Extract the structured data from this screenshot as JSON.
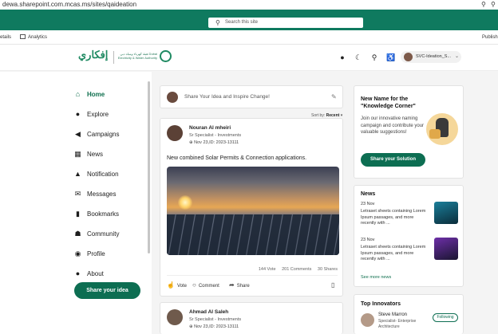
{
  "browser": {
    "url": "dewa.sharepoint.com.mcas.ms/sites/qaideation",
    "key_icon": "key-icon",
    "zoom_icon": "zoom-icon"
  },
  "suitebar": {
    "search_placeholder": "Search this site"
  },
  "cmdbar": {
    "details": "etails",
    "analytics": "Analytics",
    "published": "Publish"
  },
  "header": {
    "logo_arabic": "إفكاري",
    "logo_dewa_text": "هيئة كهرباء ومياه دبي Dubai Electricity & Water Authority",
    "profile_name": "SVC-Ideation_S...",
    "icons": [
      "sun-icon",
      "moon-icon",
      "search-icon",
      "accessibility-icon"
    ]
  },
  "sidebar": {
    "items": [
      {
        "label": "Home",
        "icon": "home-icon",
        "active": true
      },
      {
        "label": "Explore",
        "icon": "lightbulb-icon"
      },
      {
        "label": "Campaigns",
        "icon": "megaphone-icon"
      },
      {
        "label": "News",
        "icon": "newspaper-icon"
      },
      {
        "label": "Notification",
        "icon": "bell-icon"
      },
      {
        "label": "Messages",
        "icon": "mail-icon"
      },
      {
        "label": "Bookmarks",
        "icon": "bookmark-icon"
      },
      {
        "label": "Community",
        "icon": "community-icon"
      },
      {
        "label": "Profile",
        "icon": "user-icon"
      },
      {
        "label": "About",
        "icon": "info-icon"
      }
    ],
    "share_button": "Share your idea"
  },
  "composer": {
    "placeholder": "Share Your Idea and Inspire Change!"
  },
  "sort": {
    "label": "Sort by:",
    "value": "Recent"
  },
  "posts": [
    {
      "author": "Nouran Al mheiri",
      "role": "Sr Specialist - Investments",
      "id": "Nov 23,ID: 2023-13111",
      "text": "New combined Solar Permits & Connection applications.",
      "votes": "144 Vote",
      "comments": "201 Comments",
      "shares": "30 Shares",
      "actions": {
        "vote": "Vote",
        "comment": "Comment",
        "share": "Share"
      }
    },
    {
      "author": "Ahmad Al Saleh",
      "role": "Sr Specialist - Investments",
      "id": "Nov 23,ID: 2023-13111"
    }
  ],
  "promo": {
    "title": "New Name for the \"Knowledge Corner\"",
    "description": "Join our innovative naming campaign and contribute your valuable suggestions!",
    "cta": "Share your Solution"
  },
  "news": {
    "title": "News",
    "items": [
      {
        "date": "23 Nov",
        "text": "Letraset sheets containing Lorem Ipsum passages, and more recently with ..."
      },
      {
        "date": "23 Nov",
        "text": "Letraset sheets containing Lorem Ipsum passages, and more recently with ..."
      }
    ],
    "more": "See more news"
  },
  "innovators": {
    "title": "Top Innovators",
    "items": [
      {
        "name": "Steve Marron",
        "role": "Specialist- Enterprise Architecture",
        "follow": "Following"
      }
    ]
  },
  "colors": {
    "brand": "#0f7a5f",
    "button": "#0d6e52",
    "active_nav": "#0f6f4e"
  }
}
